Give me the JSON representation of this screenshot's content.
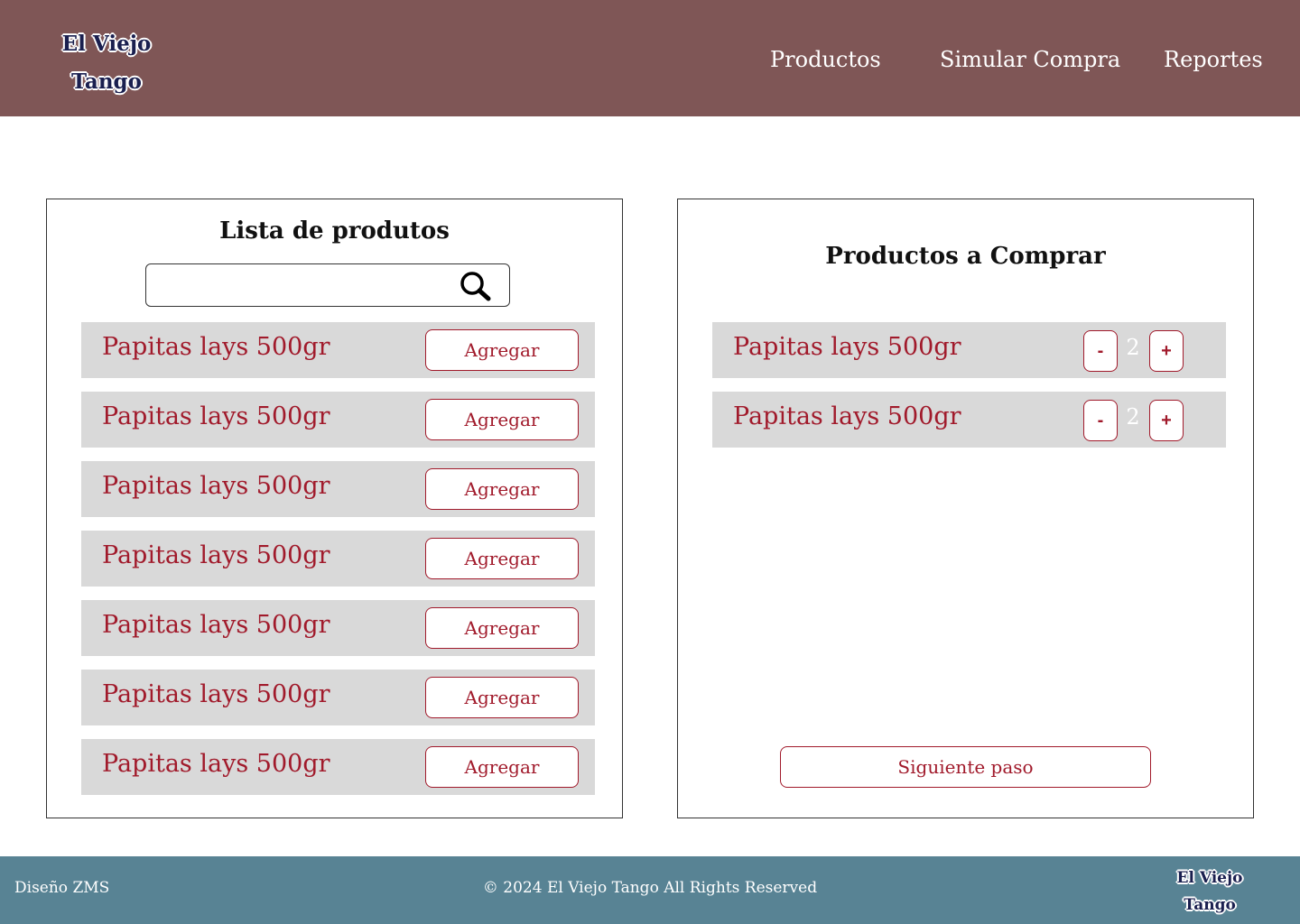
{
  "header": {
    "logo_line1": "El Viejo",
    "logo_line2": "Tango",
    "nav": {
      "productos": "Productos",
      "simular": "Simular Compra",
      "reportes": "Reportes"
    }
  },
  "product_list": {
    "title": "Lista de produtos",
    "search": {
      "value": "",
      "placeholder": ""
    },
    "items": [
      {
        "label": "Papitas lays 500gr",
        "button": "Agregar"
      },
      {
        "label": "Papitas lays 500gr",
        "button": "Agregar"
      },
      {
        "label": "Papitas lays 500gr",
        "button": "Agregar"
      },
      {
        "label": "Papitas lays 500gr",
        "button": "Agregar"
      },
      {
        "label": "Papitas lays 500gr",
        "button": "Agregar"
      },
      {
        "label": "Papitas lays 500gr",
        "button": "Agregar"
      },
      {
        "label": "Papitas lays 500gr",
        "button": "Agregar"
      }
    ]
  },
  "cart": {
    "title": "Productos a Comprar",
    "items": [
      {
        "label": "Papitas lays 500gr",
        "minus": "-",
        "quantity": "2",
        "plus": "+"
      },
      {
        "label": "Papitas lays 500gr",
        "minus": "-",
        "quantity": "2",
        "plus": "+"
      }
    ],
    "next_button": "Siguiente paso"
  },
  "footer": {
    "design": "Diseño ZMS",
    "copyright": "© 2024  El Viejo Tango All Rights Reserved",
    "logo_line1": "El Viejo",
    "logo_line2": "Tango"
  },
  "colors": {
    "header_bg": "#7f5656",
    "footer_bg": "#588394",
    "accent": "#a11a2b",
    "row_bg": "#d9d9d9",
    "logo_text": "#1a1f4f"
  },
  "icons": {
    "search": "search-icon"
  }
}
